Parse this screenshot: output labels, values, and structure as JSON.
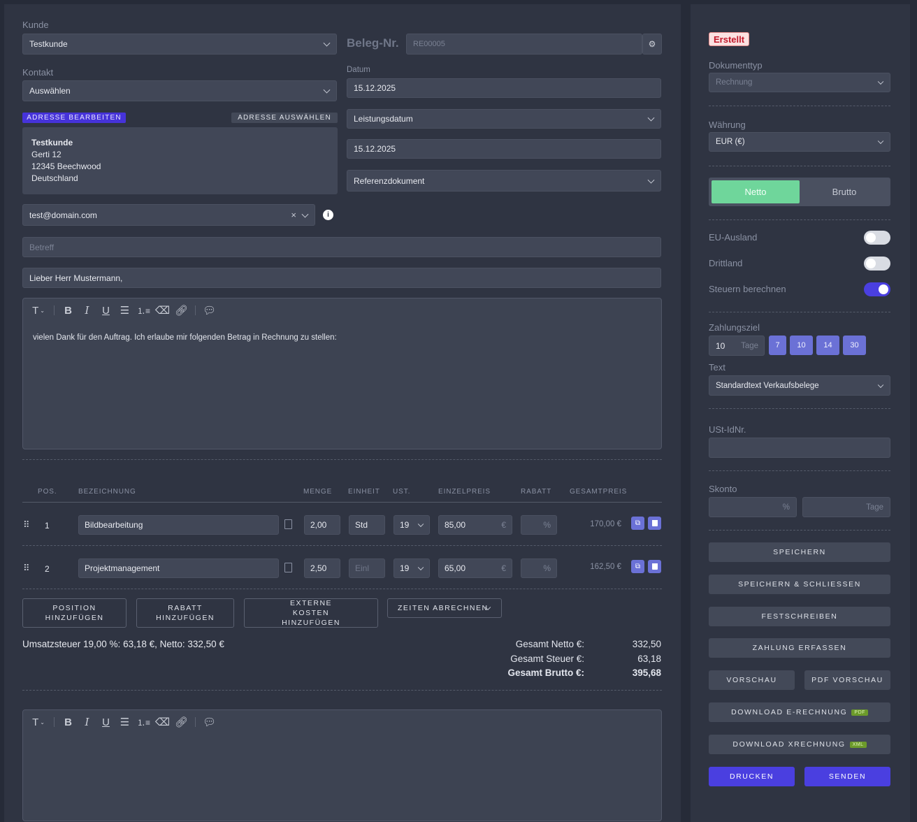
{
  "customer": {
    "label": "Kunde",
    "value": "Testkunde"
  },
  "contact": {
    "label": "Kontakt",
    "value": "Auswählen"
  },
  "beleg": {
    "label": "Beleg-Nr.",
    "placeholder": "RE00005"
  },
  "datum": {
    "label": "Datum",
    "value": "15.12.2025"
  },
  "leistungsdatum": {
    "value": "Leistungsdatum"
  },
  "leistungsdatum_value": "15.12.2025",
  "referenz": "Referenzdokument",
  "address": {
    "edit_label": "ADRESSE BEARBEITEN",
    "select_label": "ADRESSE AUSWÄHLEN",
    "lines": [
      "Testkunde",
      "Gerti 12",
      "12345 Beechwood",
      "Deutschland"
    ]
  },
  "email": "test@domain.com",
  "betreff_placeholder": "Betreff",
  "greeting": "Lieber Herr Mustermann,",
  "editor_text": "vielen Dank für den Auftrag. Ich erlaube mir folgenden Betrag in Rechnung zu stellen:",
  "table": {
    "headers": {
      "pos": "POS.",
      "bez": "BEZEICHNUNG",
      "menge": "MENGE",
      "einheit": "EINHEIT",
      "ust": "UST.",
      "einzel": "EINZELPREIS",
      "rabatt": "RABATT",
      "gesamt": "GESAMTPREIS"
    },
    "rows": [
      {
        "pos": "1",
        "bez": "Bildbearbeitung",
        "menge": "2,00",
        "einheit": "Std",
        "ust": "19",
        "einzel": "85,00",
        "cur": "€",
        "rabatt": "%",
        "gesamt": "170,00 €"
      },
      {
        "pos": "2",
        "bez": "Projektmanagement",
        "menge": "2,50",
        "einheit": "Einl",
        "ust": "19",
        "einzel": "65,00",
        "cur": "€",
        "rabatt": "%",
        "gesamt": "162,50 €"
      }
    ]
  },
  "actions": {
    "add_pos": "POSITION HINZUFÜGEN",
    "add_rabatt": "RABATT HINZUFÜGEN",
    "ext": "EXTERNE KOSTEN HINZUFÜGEN",
    "zeiten": "ZEITEN ABRECHNEN"
  },
  "summary": {
    "tax_line": "Umsatzsteuer 19,00 %: 63,18 €, Netto: 332,50 €",
    "netto_label": "Gesamt Netto €:",
    "netto": "332,50",
    "steuer_label": "Gesamt Steuer €:",
    "steuer": "63,18",
    "brutto_label": "Gesamt Brutto €:",
    "brutto": "395,68"
  },
  "side": {
    "status": "Erstellt",
    "doctype_label": "Dokumenttyp",
    "doctype": "Rechnung",
    "currency_label": "Währung",
    "currency": "EUR (€)",
    "netto": "Netto",
    "brutto": "Brutto",
    "eu_label": "EU-Ausland",
    "eu_on": false,
    "dritt_label": "Drittland",
    "dritt_on": false,
    "steuer_label": "Steuern berechnen",
    "steuer_on": true,
    "zahlungsziel_label": "Zahlungsziel",
    "zahlungsziel": "10",
    "tage": "Tage",
    "chips": [
      "7",
      "10",
      "14",
      "30"
    ],
    "text_label": "Text",
    "text": "Standardtext Verkaufsbelege",
    "ust_label": "USt-IdNr.",
    "skonto_label": "Skonto",
    "skonto_pct": "%",
    "skonto_tage": "Tage",
    "speichern": "SPEICHERN",
    "speichern_schliessen": "SPEICHERN & SCHLIESSEN",
    "festschreiben": "FESTSCHREIBEN",
    "zahlung": "ZAHLUNG ERFASSEN",
    "vorschau": "VORSCHAU",
    "pdf_vorschau": "PDF VORSCHAU",
    "download_e": "DOWNLOAD E-RECHNUNG",
    "pdf_tag": "PDF",
    "download_x": "DOWNLOAD XRECHNUNG",
    "xml_tag": "XML",
    "drucken": "DRUCKEN",
    "senden": "SENDEN",
    "accent": "#4a3fe0"
  }
}
